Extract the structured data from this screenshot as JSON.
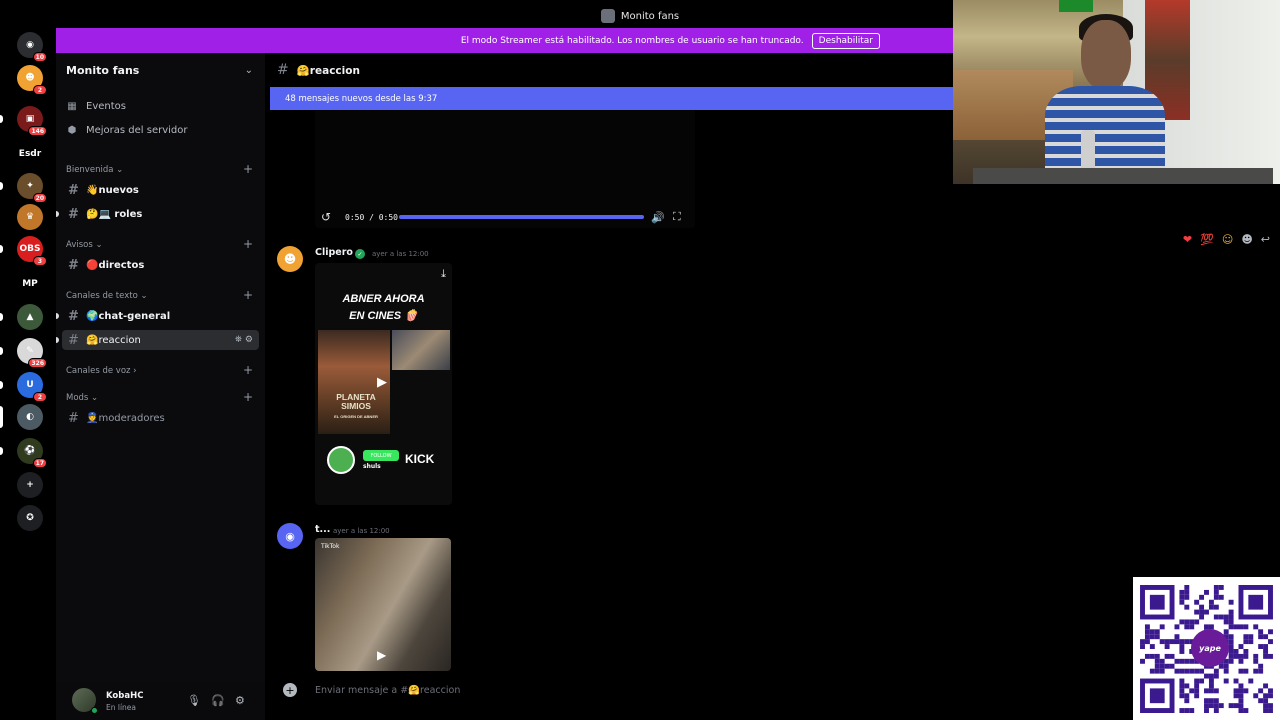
{
  "window": {
    "title": "Monito fans"
  },
  "rail": {
    "servers": [
      {
        "name": "discord-home",
        "badge": "10",
        "color": "#2b2d31",
        "glyph": "◉"
      },
      {
        "name": "server-orange",
        "badge": "2",
        "color": "#f0a232",
        "glyph": "☻"
      },
      {
        "name": "server-red",
        "badge": "146",
        "color": "#7a1a1a",
        "glyph": "▣"
      },
      {
        "name": "server-esdr",
        "badge": "",
        "color": "#000000",
        "glyph": "Esdr"
      },
      {
        "name": "server-game",
        "badge": "20",
        "color": "#6a4d2a",
        "glyph": "✦"
      },
      {
        "name": "server-crown",
        "badge": "",
        "color": "#c0772a",
        "glyph": "♛"
      },
      {
        "name": "server-obs",
        "badge": "3",
        "color": "#d81e1e",
        "glyph": "OBS"
      },
      {
        "name": "server-mp",
        "badge": "",
        "color": "#000000",
        "glyph": "MP"
      },
      {
        "name": "server-gta",
        "badge": "",
        "color": "#3c5a3a",
        "glyph": "▲"
      },
      {
        "name": "server-stripe",
        "badge": "326",
        "color": "#d9d9d9",
        "glyph": "✎"
      },
      {
        "name": "server-u",
        "badge": "2",
        "color": "#2b6be0",
        "glyph": "U"
      },
      {
        "name": "server-selected",
        "badge": "",
        "color": "#4b5a63",
        "glyph": "◐"
      },
      {
        "name": "server-fifa",
        "badge": "17",
        "color": "#2f3a1f",
        "glyph": "⚽"
      },
      {
        "name": "add-server",
        "badge": "",
        "color": "#1e1f22",
        "glyph": "+"
      },
      {
        "name": "discover",
        "badge": "",
        "color": "#1e1f22",
        "glyph": "✪"
      }
    ]
  },
  "banner": {
    "message": "El modo Streamer está habilitado. Los nombres de usuario se han truncado.",
    "button": "Deshabilitar"
  },
  "sidebar": {
    "server_name": "Monito fans",
    "items": [
      {
        "label": "Eventos",
        "icon": "calendar-icon"
      },
      {
        "label": "Mejoras del servidor",
        "icon": "boost-icon"
      }
    ],
    "categories": [
      {
        "label": "Bienvenida ⌄"
      },
      {
        "label": "Avisos ⌄"
      },
      {
        "label": "Canales de texto ⌄"
      },
      {
        "label": "Canales de voz ›"
      },
      {
        "label": "Mods ⌄"
      }
    ],
    "channels": [
      {
        "label": "👋nuevos"
      },
      {
        "label": "🤔💻 roles"
      },
      {
        "label": "🔴directos"
      },
      {
        "label": "🌍chat-general"
      },
      {
        "label": "🤗reaccion"
      },
      {
        "label": "👮moderadores"
      }
    ]
  },
  "user": {
    "name": "KobaHC",
    "status": "En línea"
  },
  "chat": {
    "channel_name": "🤗reaccion",
    "new_messages": "48 mensajes nuevos desde las 9:37",
    "video": {
      "time": "0:50 / 0:50",
      "progress": 1.0
    },
    "messages": [
      {
        "author": "Clipero",
        "time": "ayer a las 12:00"
      },
      {
        "author": "t...",
        "time": "ayer a las 12:00"
      }
    ],
    "tiktok1": {
      "headline1": "ABNER AHORA",
      "headline2": "EN CINES 🍿",
      "poster_text": "PLANETA SIMIOS",
      "poster_sub": "EL ORIGEN DE ABNER",
      "follow_badge": "FOLLOW",
      "handle": "shuls",
      "kick": "KICK"
    },
    "tiktok2": {
      "label": "TikTok"
    },
    "composer_placeholder": "Enviar mensaje a #🤗reaccion"
  },
  "qr": {
    "brand": "yape"
  },
  "colors": {
    "accent": "#5865f2",
    "streamer_banner": "#a020e8",
    "online": "#23a559"
  }
}
